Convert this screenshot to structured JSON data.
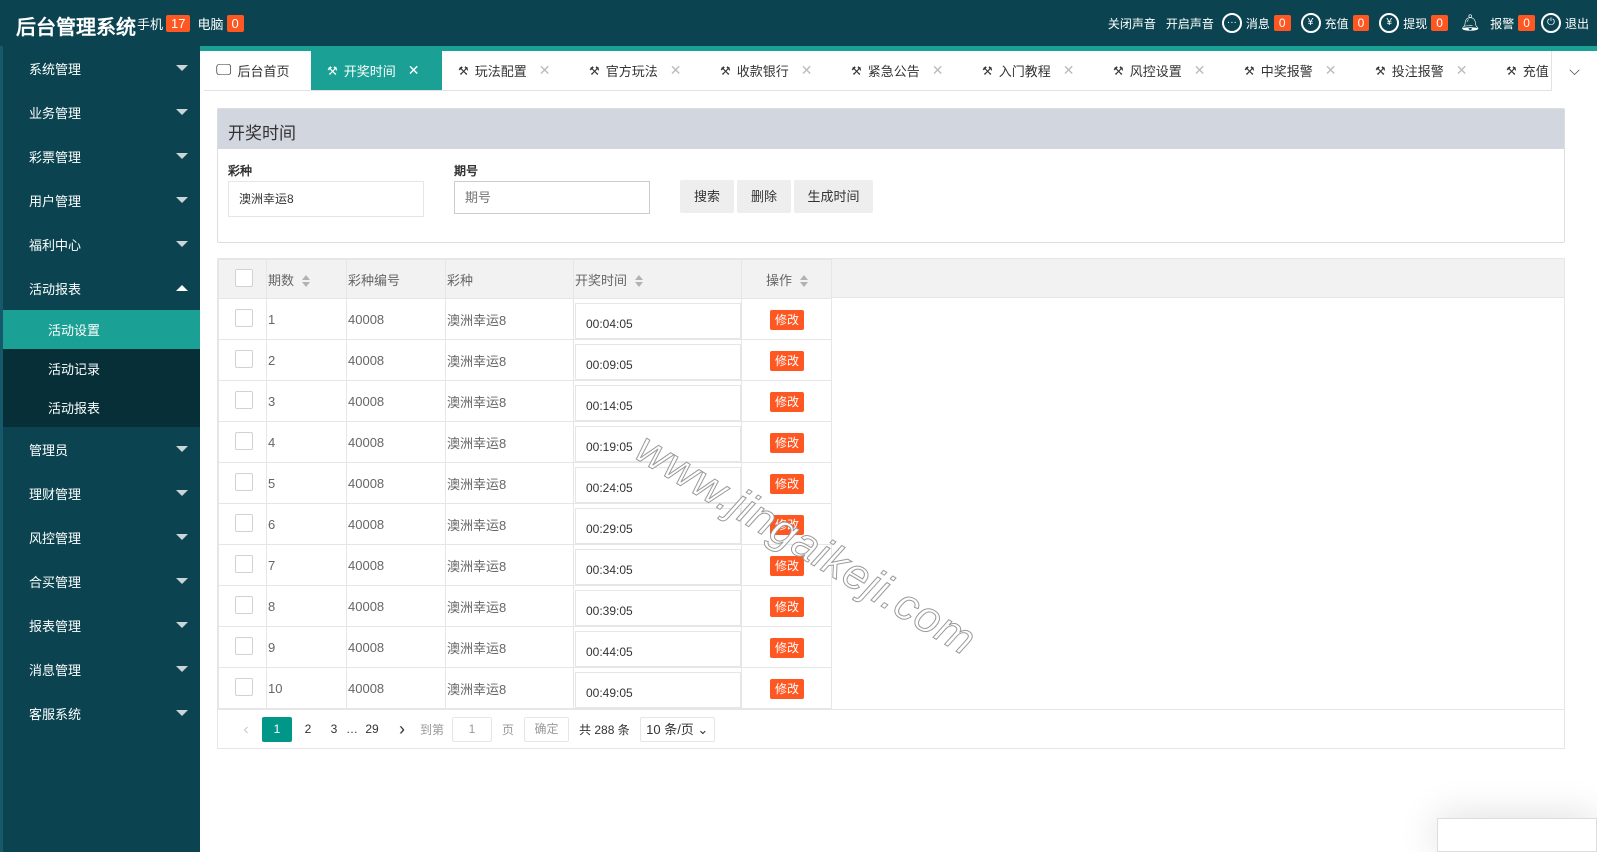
{
  "header": {
    "title": "后台管理系统",
    "mobile_label": "手机",
    "mobile_count": "17",
    "pc_label": "电脑",
    "pc_count": "0",
    "sound_off": "关闭声音",
    "sound_on": "开启声音",
    "msg_label": "消息",
    "msg_count": "0",
    "recharge_label": "充值",
    "recharge_count": "0",
    "withdraw_label": "提现",
    "withdraw_count": "0",
    "alarm_label": "报警",
    "alarm_count": "0",
    "logout_label": "退出"
  },
  "sidebar": {
    "items": [
      {
        "label": "系统管理"
      },
      {
        "label": "业务管理"
      },
      {
        "label": "彩票管理"
      },
      {
        "label": "用户管理"
      },
      {
        "label": "福利中心"
      },
      {
        "label": "活动报表",
        "expanded": true
      }
    ],
    "sub": [
      {
        "label": "活动设置",
        "active": true
      },
      {
        "label": "活动记录"
      },
      {
        "label": "活动报表"
      }
    ],
    "items2": [
      {
        "label": "管理员"
      },
      {
        "label": "理财管理"
      },
      {
        "label": "风控管理"
      },
      {
        "label": "合买管理"
      },
      {
        "label": "报表管理"
      },
      {
        "label": "消息管理"
      },
      {
        "label": "客服系统"
      }
    ]
  },
  "tabs": [
    {
      "label": "后台首页"
    },
    {
      "label": "开奖时间",
      "active": true
    },
    {
      "label": "玩法配置"
    },
    {
      "label": "官方玩法"
    },
    {
      "label": "收款银行"
    },
    {
      "label": "紧急公告"
    },
    {
      "label": "入门教程"
    },
    {
      "label": "风控设置"
    },
    {
      "label": "中奖报警"
    },
    {
      "label": "投注报警"
    },
    {
      "label": "充值"
    }
  ],
  "panel": {
    "title": "开奖时间",
    "lottery_label": "彩种",
    "lottery_value": "澳洲幸运8",
    "issue_label": "期号",
    "issue_placeholder": "期号",
    "search": "搜索",
    "delete": "删除",
    "generate": "生成时间"
  },
  "table": {
    "headers": [
      "期数",
      "彩种编号",
      "彩种",
      "开奖时间",
      "操作"
    ],
    "edit_label": "修改",
    "rows": [
      [
        "1",
        "40008",
        "澳洲幸运8",
        "00:04:05"
      ],
      [
        "2",
        "40008",
        "澳洲幸运8",
        "00:09:05"
      ],
      [
        "3",
        "40008",
        "澳洲幸运8",
        "00:14:05"
      ],
      [
        "4",
        "40008",
        "澳洲幸运8",
        "00:19:05"
      ],
      [
        "5",
        "40008",
        "澳洲幸运8",
        "00:24:05"
      ],
      [
        "6",
        "40008",
        "澳洲幸运8",
        "00:29:05"
      ],
      [
        "7",
        "40008",
        "澳洲幸运8",
        "00:34:05"
      ],
      [
        "8",
        "40008",
        "澳洲幸运8",
        "00:39:05"
      ],
      [
        "9",
        "40008",
        "澳洲幸运8",
        "00:44:05"
      ],
      [
        "10",
        "40008",
        "澳洲幸运8",
        "00:49:05"
      ]
    ]
  },
  "pager": {
    "pages": [
      "1",
      "2",
      "3"
    ],
    "ellipsis": "…",
    "last": "29",
    "goto": "到第",
    "goto_value": "1",
    "page_unit": "页",
    "confirm": "确定",
    "total": "共 288 条",
    "per_page": "10 条/页"
  },
  "watermark": "www.jingaikeji.com",
  "colors": {
    "header": "#0b4450",
    "accent": "#1aa094",
    "badge": "#ff5722"
  }
}
